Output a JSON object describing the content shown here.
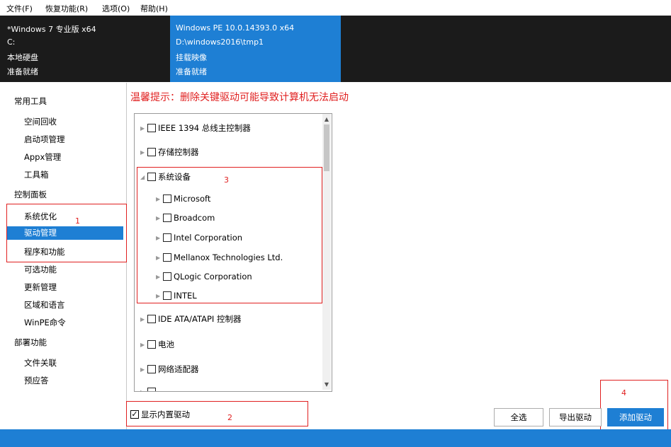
{
  "menu": {
    "items": [
      "文件(F)",
      "恢复功能(R)",
      "选项(O)",
      "帮助(H)"
    ]
  },
  "header": {
    "left": [
      "*Windows 7 专业版 x64",
      "C:",
      "本地硬盘",
      "准备就绪"
    ],
    "right": [
      "Windows PE 10.0.14393.0 x64",
      "D:\\windows2016\\tmp1",
      "挂载映像",
      "准备就绪"
    ]
  },
  "sidebar": {
    "cat_tools": "常用工具",
    "tools": [
      "空间回收",
      "启动项管理",
      "Appx管理",
      "工具箱"
    ],
    "cat_control": "控制面板",
    "control": [
      "系统优化",
      "驱动管理",
      "程序和功能",
      "可选功能",
      "更新管理",
      "区域和语言",
      "WinPE命令"
    ],
    "cat_deploy": "部署功能",
    "deploy": [
      "文件关联",
      "预应答"
    ]
  },
  "warning": "温馨提示：删除关键驱动可能导致计算机无法启动",
  "tree": {
    "items": [
      "IEEE 1394 总线主控制器",
      "存储控制器",
      "系统设备",
      "Microsoft",
      "Broadcom",
      "Intel Corporation",
      "Mellanox Technologies Ltd.",
      "QLogic Corporation",
      "INTEL",
      "IDE ATA/ATAPI 控制器",
      "电池",
      "网络适配器"
    ]
  },
  "annotations": [
    "1",
    "2",
    "3",
    "4"
  ],
  "bottom": {
    "show_builtin": "显示内置驱动",
    "select_all": "全选",
    "export": "导出驱动",
    "add": "添加驱动"
  },
  "colors": {
    "accent": "#1e7fd4",
    "warning": "#e02020",
    "header_bg": "#1b1b1b"
  }
}
